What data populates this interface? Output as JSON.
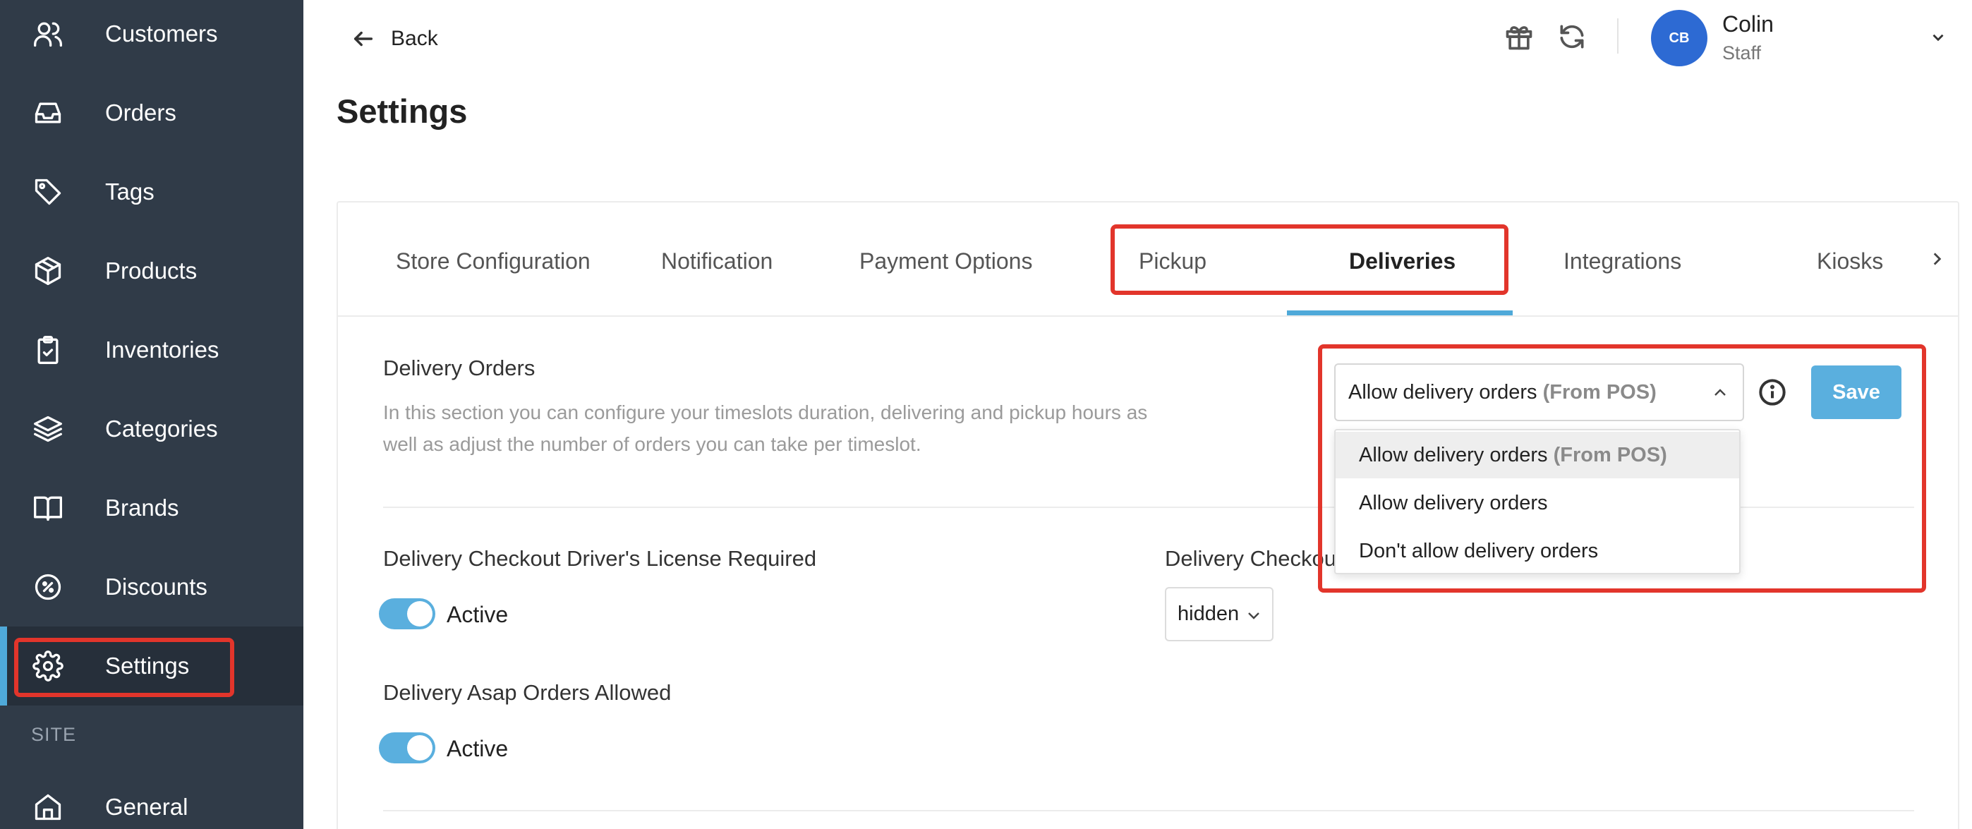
{
  "sidebar": {
    "items": [
      {
        "label": "Customers",
        "icon": "users-icon"
      },
      {
        "label": "Orders",
        "icon": "inbox-icon"
      },
      {
        "label": "Tags",
        "icon": "tag-icon"
      },
      {
        "label": "Products",
        "icon": "package-icon"
      },
      {
        "label": "Inventories",
        "icon": "clipboard-check-icon"
      },
      {
        "label": "Categories",
        "icon": "layers-icon"
      },
      {
        "label": "Brands",
        "icon": "book-open-icon"
      },
      {
        "label": "Discounts",
        "icon": "percent-badge-icon"
      },
      {
        "label": "Settings",
        "icon": "gear-icon",
        "active": true
      }
    ],
    "section_label": "SITE",
    "site_items": [
      {
        "label": "General",
        "icon": "home-icon"
      }
    ]
  },
  "header": {
    "back_label": "Back",
    "user": {
      "initials": "CB",
      "name": "Colin",
      "role": "Staff"
    }
  },
  "page": {
    "title": "Settings"
  },
  "tabs": [
    {
      "label": "Store Configuration"
    },
    {
      "label": "Notification"
    },
    {
      "label": "Payment Options"
    },
    {
      "label": "Pickup"
    },
    {
      "label": "Deliveries",
      "active": true
    },
    {
      "label": "Integrations"
    },
    {
      "label": "Kiosks"
    }
  ],
  "delivery_orders": {
    "title": "Delivery Orders",
    "description": "In this section you can configure your timeslots duration, delivering and pickup hours as well as adjust the number of orders you can take per timeslot.",
    "select": {
      "value": "Allow delivery orders",
      "value_suffix": "(From POS)"
    },
    "options": [
      {
        "label": "Allow delivery orders",
        "suffix": "(From POS)",
        "selected": true
      },
      {
        "label": "Allow delivery orders",
        "suffix": ""
      },
      {
        "label": "Don't allow delivery orders",
        "suffix": ""
      }
    ],
    "save_label": "Save"
  },
  "license_required": {
    "title": "Delivery Checkout Driver's License Required",
    "state_label": "Active"
  },
  "checkout_field": {
    "title_visible": "Delivery Checkou",
    "select_value": "hidden"
  },
  "asap_orders": {
    "title": "Delivery Asap Orders Allowed",
    "state_label": "Active"
  },
  "colors": {
    "sidebar_bg": "#303b48",
    "accent": "#4fa9d9",
    "avatar": "#2d6ad3",
    "annotation": "#e2352b"
  }
}
